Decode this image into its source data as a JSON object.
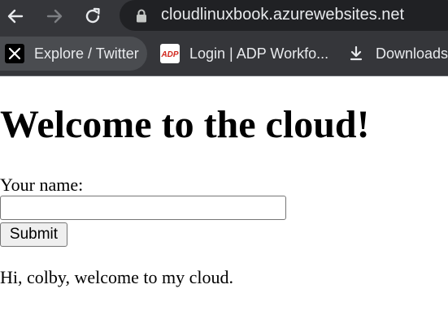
{
  "browser": {
    "url": "cloudlinuxbook.azurewebsites.net",
    "bookmarks": [
      {
        "label": "Explore / Twitter",
        "icon": "x-logo-icon"
      },
      {
        "label": "Login | ADP Workfo...",
        "icon": "adp-logo-icon"
      },
      {
        "label": "Downloads",
        "icon": "download-icon"
      }
    ],
    "colors": {
      "toolbar": "#35363a",
      "omnibox": "#202124",
      "text": "#e8eaed",
      "adp_red": "#d0271d"
    }
  },
  "page": {
    "heading": "Welcome to the cloud!",
    "name_label": "Your name:",
    "name_value": "",
    "submit_label": "Submit",
    "greeting": "Hi, colby, welcome to my cloud."
  }
}
